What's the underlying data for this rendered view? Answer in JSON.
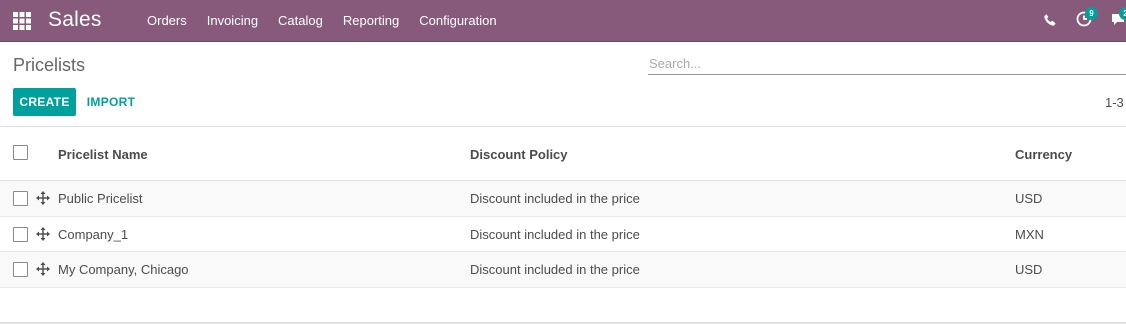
{
  "navbar": {
    "app_name": "Sales",
    "menu": [
      "Orders",
      "Invoicing",
      "Catalog",
      "Reporting",
      "Configuration"
    ],
    "activity_badge": "9",
    "messages_badge": "2",
    "color": "#875a7b"
  },
  "control_panel": {
    "breadcrumb": "Pricelists",
    "search_placeholder": "Search...",
    "create_label": "CREATE",
    "import_label": "IMPORT",
    "pager": "1-3",
    "accent_color": "#00a09d"
  },
  "table": {
    "columns": [
      "Pricelist Name",
      "Discount Policy",
      "Currency"
    ],
    "rows": [
      {
        "name": "Public Pricelist",
        "policy": "Discount included in the price",
        "currency": "USD"
      },
      {
        "name": "Company_1",
        "policy": "Discount included in the price",
        "currency": "MXN"
      },
      {
        "name": "My Company, Chicago",
        "policy": "Discount included in the price",
        "currency": "USD"
      }
    ]
  }
}
